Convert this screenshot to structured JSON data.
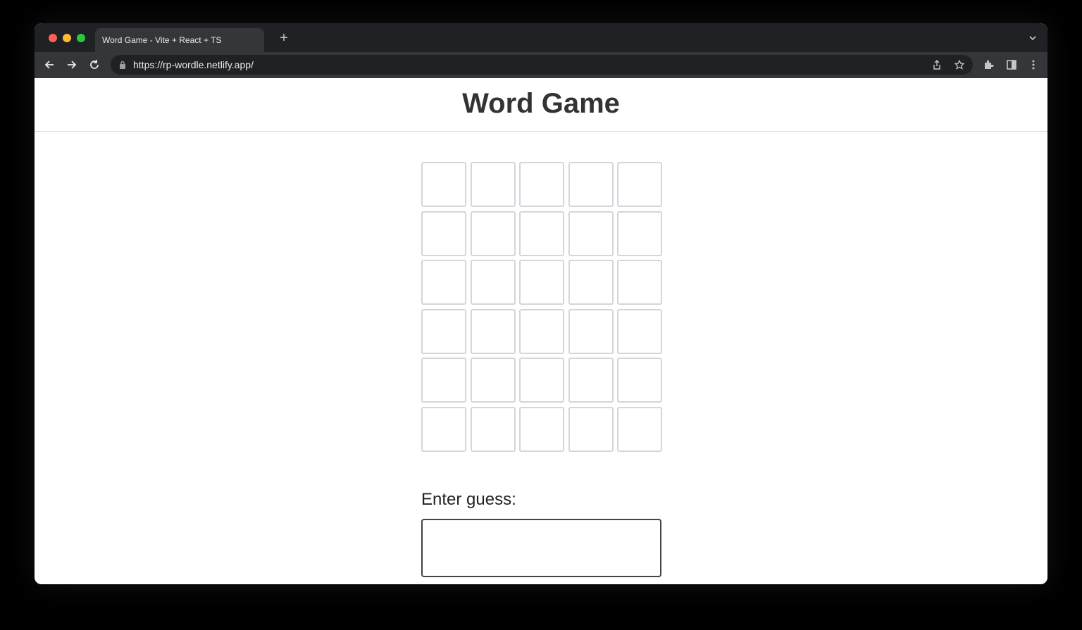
{
  "browser": {
    "tab_title": "Word Game - Vite + React + TS",
    "new_tab_symbol": "+",
    "url": "https://rp-wordle.netlify.app/"
  },
  "page": {
    "title": "Word Game",
    "board": {
      "rows": [
        [
          "",
          "",
          "",
          "",
          ""
        ],
        [
          "",
          "",
          "",
          "",
          ""
        ],
        [
          "",
          "",
          "",
          "",
          ""
        ],
        [
          "",
          "",
          "",
          "",
          ""
        ],
        [
          "",
          "",
          "",
          "",
          ""
        ],
        [
          "",
          "",
          "",
          "",
          ""
        ]
      ]
    },
    "guess_label": "Enter guess:",
    "guess_value": ""
  },
  "colors": {
    "tile_border": "#d3d6da",
    "input_border": "#444444",
    "title_text": "#333333"
  }
}
